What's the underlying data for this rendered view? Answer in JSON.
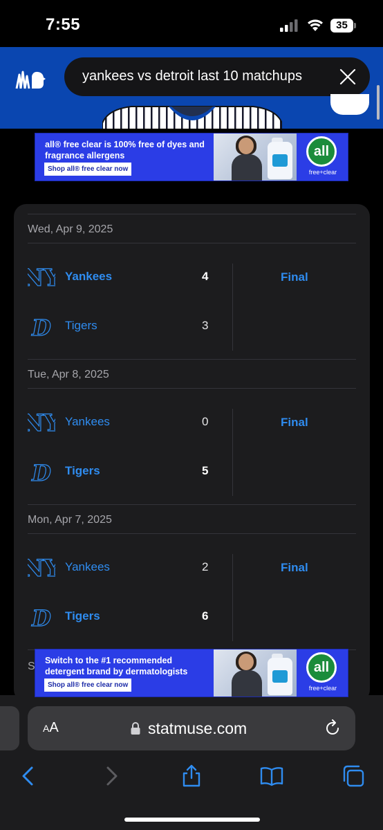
{
  "status_bar": {
    "time": "7:55",
    "battery": "35"
  },
  "header": {
    "search_query": "yankees vs detroit last 10 matchups",
    "accent_color": "#0a46b0"
  },
  "ads": {
    "top": {
      "text": "all® free clear is 100% free of dyes and fragrance allergens",
      "button": "Shop all® free clear now",
      "brand": "all",
      "brand_sub": "free+clear"
    },
    "bottom": {
      "text": "Switch to the #1 recommended detergent brand by dermatologists",
      "button": "Shop all® free clear now",
      "brand": "all",
      "brand_sub": "free+clear"
    }
  },
  "games": [
    {
      "date": "Wed, Apr 9, 2025",
      "status": "Final",
      "teams": [
        {
          "name": "Yankees",
          "score": "4",
          "winner": true,
          "logo": "yankees-logo-icon"
        },
        {
          "name": "Tigers",
          "score": "3",
          "winner": false,
          "logo": "tigers-logo-icon"
        }
      ]
    },
    {
      "date": "Tue, Apr 8, 2025",
      "status": "Final",
      "teams": [
        {
          "name": "Yankees",
          "score": "0",
          "winner": false,
          "logo": "yankees-logo-icon"
        },
        {
          "name": "Tigers",
          "score": "5",
          "winner": true,
          "logo": "tigers-logo-icon"
        }
      ]
    },
    {
      "date": "Mon, Apr 7, 2025",
      "status": "Final",
      "teams": [
        {
          "name": "Yankees",
          "score": "2",
          "winner": false,
          "logo": "yankees-logo-icon"
        },
        {
          "name": "Tigers",
          "score": "6",
          "winner": true,
          "logo": "tigers-logo-icon"
        }
      ]
    }
  ],
  "partial_next_date": "S",
  "browser": {
    "text_size_big": "A",
    "text_size_small": "A",
    "url": "statmuse.com",
    "link_color": "#2f8cf0"
  }
}
